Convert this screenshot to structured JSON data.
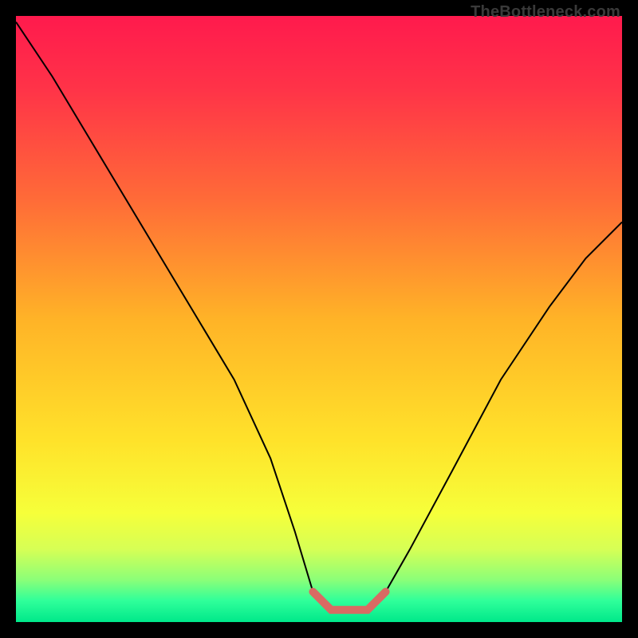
{
  "watermark": "TheBottleneck.com",
  "chart_data": {
    "type": "line",
    "title": "",
    "xlabel": "",
    "ylabel": "",
    "xlim": [
      0,
      100
    ],
    "ylim": [
      0,
      100
    ],
    "grid": false,
    "series": [
      {
        "name": "bottleneck-curve",
        "x": [
          0,
          6,
          12,
          18,
          24,
          30,
          36,
          42,
          46,
          49,
          52,
          55,
          58,
          61,
          65,
          72,
          80,
          88,
          94,
          100
        ],
        "values": [
          99,
          90,
          80,
          70,
          60,
          50,
          40,
          27,
          15,
          5,
          2,
          2,
          2,
          5,
          12,
          25,
          40,
          52,
          60,
          66
        ]
      }
    ],
    "highlight_band": {
      "x_start": 49,
      "x_end": 61,
      "color": "#d96a63"
    },
    "background_gradient_stops": [
      {
        "pos": 0.0,
        "color": "#ff1a4d"
      },
      {
        "pos": 0.12,
        "color": "#ff3348"
      },
      {
        "pos": 0.3,
        "color": "#ff6a38"
      },
      {
        "pos": 0.5,
        "color": "#ffb327"
      },
      {
        "pos": 0.7,
        "color": "#ffe22a"
      },
      {
        "pos": 0.82,
        "color": "#f6ff3a"
      },
      {
        "pos": 0.88,
        "color": "#d6ff55"
      },
      {
        "pos": 0.93,
        "color": "#8cff78"
      },
      {
        "pos": 0.965,
        "color": "#2fff9a"
      },
      {
        "pos": 1.0,
        "color": "#00e88a"
      }
    ]
  }
}
